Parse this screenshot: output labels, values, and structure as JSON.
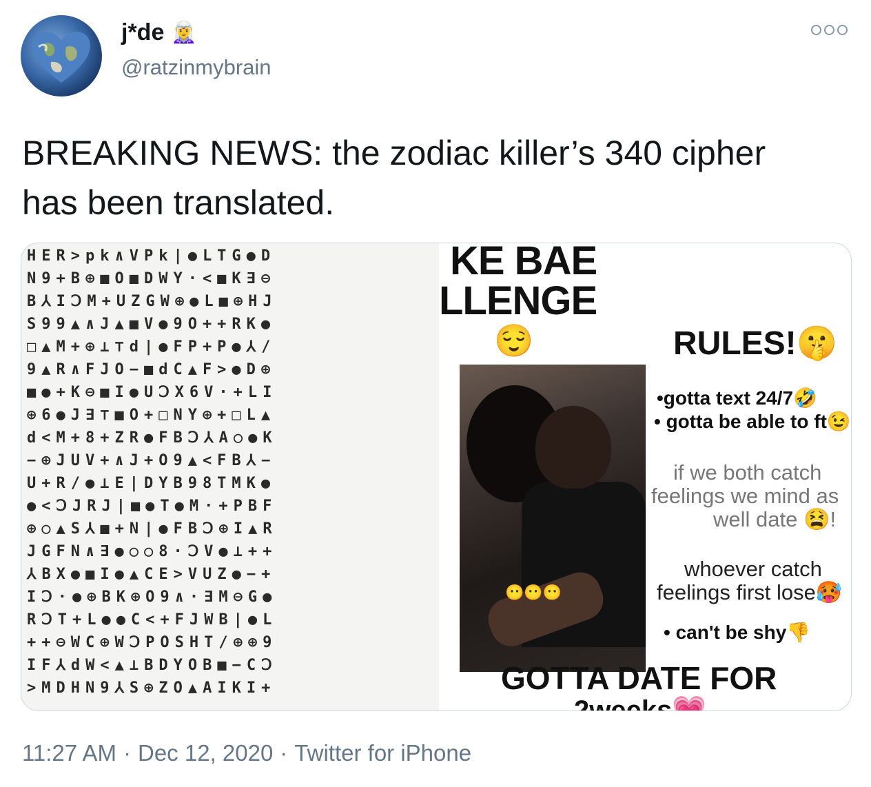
{
  "user": {
    "display_name": "j*de",
    "name_emoji": "🧝‍♀️",
    "handle": "@ratzinmybrain"
  },
  "tweet": {
    "text_line1": "BREAKING NEWS: the zodiac killer’s 340 cipher",
    "text_line2": "has been translated."
  },
  "media": {
    "cipher_rows": [
      "HER>pk∧VPk|●LTG●D",
      "N9+B⊕■O■DWY·<■K∃⊖",
      "B⅄IↃM+UZGW⊕●L■⊕HJ",
      "S99▲∧J▲■V●9O++RK●",
      "□▲M+⊕⊥⊤d|●FP+P●⅄/",
      "9▲R∧FJO−■dC▲F>●D⊕",
      "■●+K⊖■I●UↃX6V·+LI",
      "⊕6●J∃⊤■O+□NY⊕+□L▲",
      "d<M+8+ZR●FBↃ⅄A○●K",
      "−⊕JUV+∧J+O9▲<FB⅄−",
      "U+R/●⊥E|DYB98TMK●",
      "●<ↃJRJ|■●T●M·+PBF",
      "⊕○▲S⅄■+N|●FBↃ⊕I▲R",
      "JGFN∧∃●○○8·ↃV●⊥++",
      "⅄BX●■I●▲CE>VUZ●−+",
      "IↃ·●⊕BK⊕O9∧·∃M⊖G●",
      "RↃT+L●●C<+FJWB|●L",
      "++⊖WC⊕WↃPOSHT/⊕⊕9",
      "IF⅄dW<▲⊥BDYOB■−CↃ",
      ">MDHN9⅄S⊕ZO▲AIKI+"
    ],
    "poster_title_1": "KE BAE",
    "poster_title_2": "LLENGE",
    "rules_heading": "RULES!",
    "rule_1": "•gotta text 24/7",
    "rule_2": "• gotta be able to ft",
    "catch_line_1": "if we both catch",
    "catch_line_2": "feelings we mind as",
    "catch_line_3": "well date 😫!",
    "lose_line_1": "whoever catch",
    "lose_line_2": "feelings first lose",
    "rule_shy": "• can't be shy👎",
    "bottom_title": "GOTTA DATE FOR",
    "bottom_cut": "2weeks💗",
    "photo_emojis": "😶😶😶",
    "smile_emoji": "😌",
    "rules_emoji": "🤫",
    "text_emoji": "🤣",
    "ft_emoji": "😉",
    "lose_emoji": "🥵"
  },
  "meta": {
    "time": "11:27 AM",
    "sep1": "·",
    "date": "Dec 12, 2020",
    "sep2": "·",
    "source": "Twitter for iPhone"
  }
}
